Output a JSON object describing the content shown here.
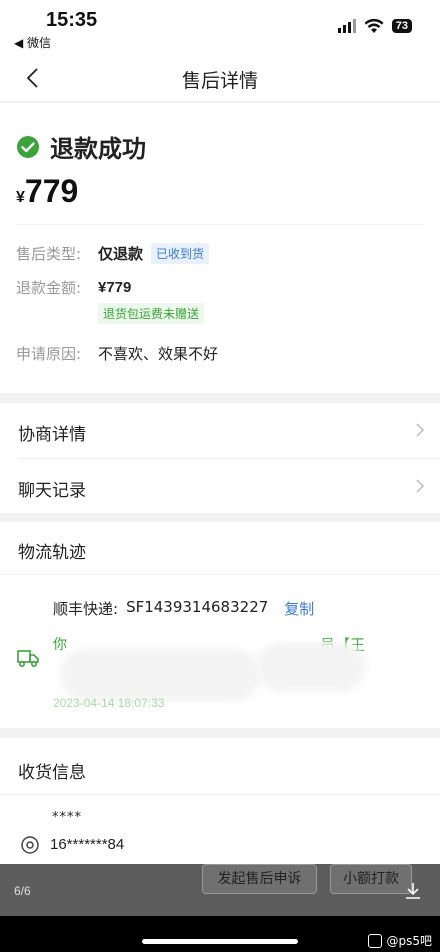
{
  "status_bar": {
    "time": "15:35",
    "back_app": "◀ 微信",
    "battery": "73"
  },
  "nav": {
    "title": "售后详情"
  },
  "refund": {
    "status": "退款成功",
    "currency": "¥",
    "amount": "779",
    "type_label": "售后类型:",
    "type_value": "仅退款",
    "type_tag": "已收到货",
    "amount_label": "退款金额:",
    "amount_value": "¥779",
    "shipping_tag": "退货包运费未赠送",
    "reason_label": "申请原因:",
    "reason_value": "不喜欢、效果不好"
  },
  "menu": {
    "items": [
      {
        "label": "协商详情"
      },
      {
        "label": "聊天记录"
      }
    ]
  },
  "logistics": {
    "title": "物流轨迹",
    "courier": "顺丰快递:",
    "tracking_no": "SF1439314683227",
    "copy": "复制",
    "trace_start": "你",
    "trace_end": "员【王",
    "trace_time": "2023-04-14 18:07:33"
  },
  "receiving": {
    "title": "收货信息",
    "name": "****",
    "phone": "16*******84"
  },
  "bottom": {
    "page": "6/6",
    "appeal": "发起售后申诉",
    "small_pay": "小额打款"
  },
  "watermark": "@ps5吧",
  "colors": {
    "success_green": "#3aa43a",
    "link_blue": "#3b7ad9"
  }
}
